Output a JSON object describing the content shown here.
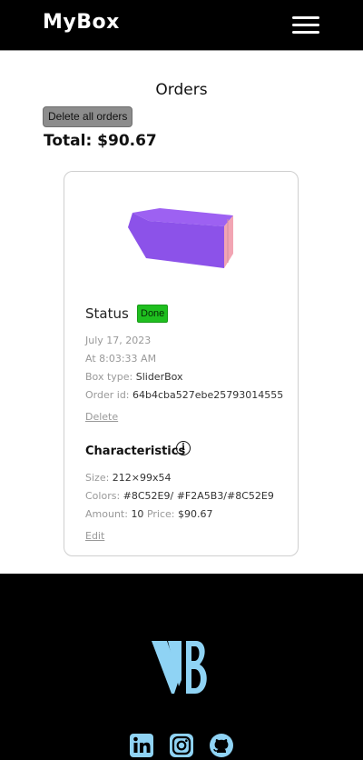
{
  "header": {
    "logo": "MyBox",
    "menu_icon": "hamburger-menu-icon"
  },
  "page": {
    "title": "Orders",
    "delete_all_label": "Delete all orders",
    "total": "Total: $90.67"
  },
  "order": {
    "status_label": "Status",
    "status_value": "Done",
    "date": "July 17, 2023",
    "time": "At 8:03:33 AM",
    "box_type_label": "Box type:",
    "box_type_value": "SliderBox",
    "order_id_label": "Order id:",
    "order_id_value": "64b4cba527ebe25793014555",
    "delete_label": "Delete",
    "characteristics_title": "Characteristics",
    "info_glyph": "i",
    "size_label": "Size:",
    "size_value": "212×99x54",
    "colors_label": "Colors:",
    "colors_value": "#8C52E9/ #F2A5B3/#8C52E9",
    "amount_label": "Amount:",
    "amount_value": "10",
    "price_label": "Price:",
    "price_value": "$90.67",
    "edit_label": "Edit",
    "box_colors": {
      "top": "#9a5cf0",
      "front": "#8C52E9",
      "side": "#F2A5B3"
    }
  },
  "footer": {
    "logo_icon": "vb-logo",
    "social": [
      "linkedin-icon",
      "instagram-icon",
      "github-icon"
    ],
    "accent": "#8fd3f4"
  }
}
